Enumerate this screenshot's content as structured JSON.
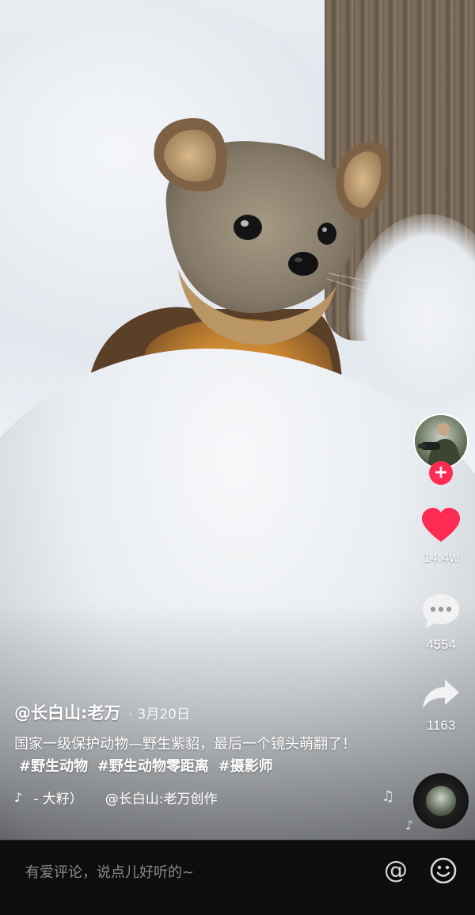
{
  "video": {
    "author": "@长白山:老万",
    "date": "3月20日",
    "caption": "国家一级保护动物—野生紫貂，最后一个镜头萌翻了！",
    "hashtags": [
      "#野生动物",
      "#野生动物零距离",
      "#摄影师"
    ],
    "music_prefix": "- 大籽）",
    "music_origin": "@长白山:老万创作"
  },
  "actions": {
    "likes": "14.4w",
    "comments": "4554",
    "shares": "1163"
  },
  "comment_bar": {
    "placeholder": "有爱评论，说点儿好听的~"
  },
  "colors": {
    "like": "#fe2c55",
    "follow": "#fe2c55",
    "bar_bg": "#0d0d0d"
  },
  "icons": [
    "avatar",
    "follow-plus-icon",
    "heart-icon",
    "comment-icon",
    "share-icon",
    "music-disc-icon",
    "tiktok-icon",
    "at-icon",
    "emoji-icon",
    "music-note-icon"
  ]
}
